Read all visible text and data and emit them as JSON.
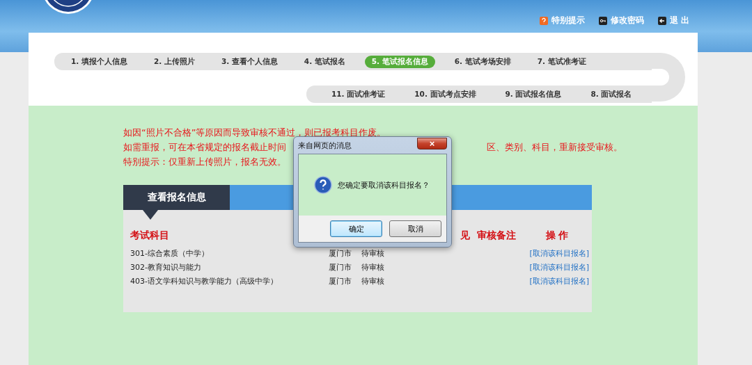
{
  "header_links": [
    {
      "kind": "tip",
      "label": "特别提示"
    },
    {
      "kind": "password",
      "label": "修改密码"
    },
    {
      "kind": "logout",
      "label": "退 出"
    }
  ],
  "steps_row_1": [
    {
      "label": "1. 填报个人信息",
      "selected": false
    },
    {
      "label": "2. 上传照片",
      "selected": false
    },
    {
      "label": "3. 查看个人信息",
      "selected": false
    },
    {
      "label": "4. 笔试报名",
      "selected": false
    },
    {
      "label": "5. 笔试报名信息",
      "selected": true
    },
    {
      "label": "6. 笔试考场安排",
      "selected": false
    },
    {
      "label": "7. 笔试准考证",
      "selected": false
    }
  ],
  "steps_row_2": [
    {
      "label": "11. 面试准考证",
      "selected": false
    },
    {
      "label": "10. 面试考点安排",
      "selected": false
    },
    {
      "label": "9. 面试报名信息",
      "selected": false
    },
    {
      "label": "8. 面试报名",
      "selected": false
    }
  ],
  "notices": [
    "如因“照片不合格”等原因而导致审核不通过，则已报考科目作废。",
    "如需重报，可在本省规定的报名截止时间",
    "区、类别、科目，重新接受审核。",
    "特别提示：仅重新上传照片，报名无效。"
  ],
  "panel": {
    "title": "查看报名信息",
    "columns": [
      "考试科目",
      "见",
      "审核备注",
      "操 作"
    ],
    "rows": [
      {
        "subject": "301-综合素质（中学）",
        "city": "厦门市",
        "status": "待审核",
        "action": "[取消该科目报名]"
      },
      {
        "subject": "302-教育知识与能力",
        "city": "厦门市",
        "status": "待审核",
        "action": "[取消该科目报名]"
      },
      {
        "subject": "403-语文学科知识与教学能力（高级中学）",
        "city": "厦门市",
        "status": "待审核",
        "action": "[取消该科目报名]"
      }
    ]
  },
  "dialog": {
    "title": "来自网页的消息",
    "close": "×",
    "message": "您确定要取消该科目报名？",
    "buttons": [
      {
        "label": "确定",
        "selected": true
      },
      {
        "label": "取消",
        "selected": false
      }
    ]
  }
}
